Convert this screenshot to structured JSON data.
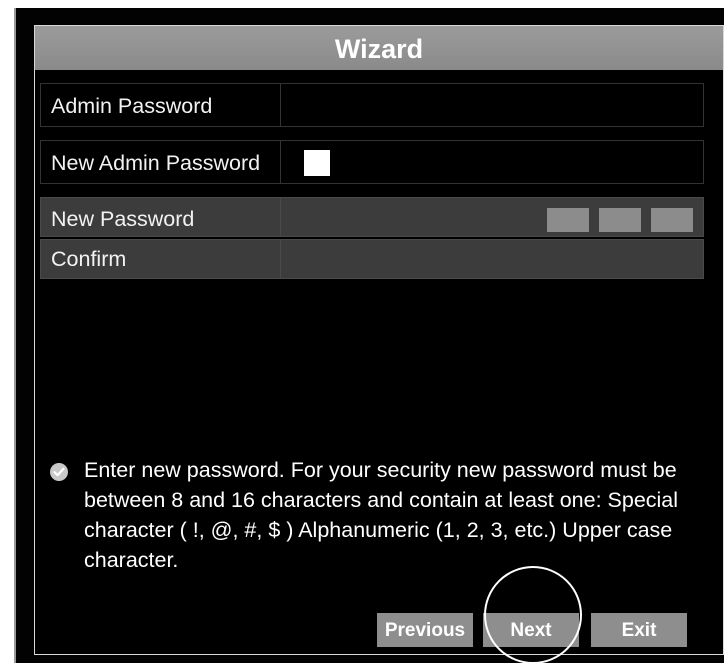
{
  "dialog": {
    "title": "Wizard"
  },
  "fields": {
    "admin_password": {
      "label": "Admin Password",
      "value": ""
    },
    "new_admin_password": {
      "label": "New Admin Password",
      "checked": false
    },
    "new_password": {
      "label": "New Password",
      "value": "",
      "strength_levels": 3
    },
    "confirm": {
      "label": "Confirm",
      "value": ""
    }
  },
  "info": {
    "icon": "check-circle-icon",
    "text": "Enter new password. For your security new password must be between 8 and 16 characters and contain at least one: Special character ( !, @, #, $ ) Alphanumeric (1, 2, 3, etc.) Upper case character."
  },
  "buttons": {
    "previous": "Previous",
    "next": "Next",
    "exit": "Exit"
  },
  "colors": {
    "background": "#000000",
    "title_bar": "#8e8e8e",
    "button": "#8e8e8e",
    "highlight_ring": "#ffffff"
  }
}
